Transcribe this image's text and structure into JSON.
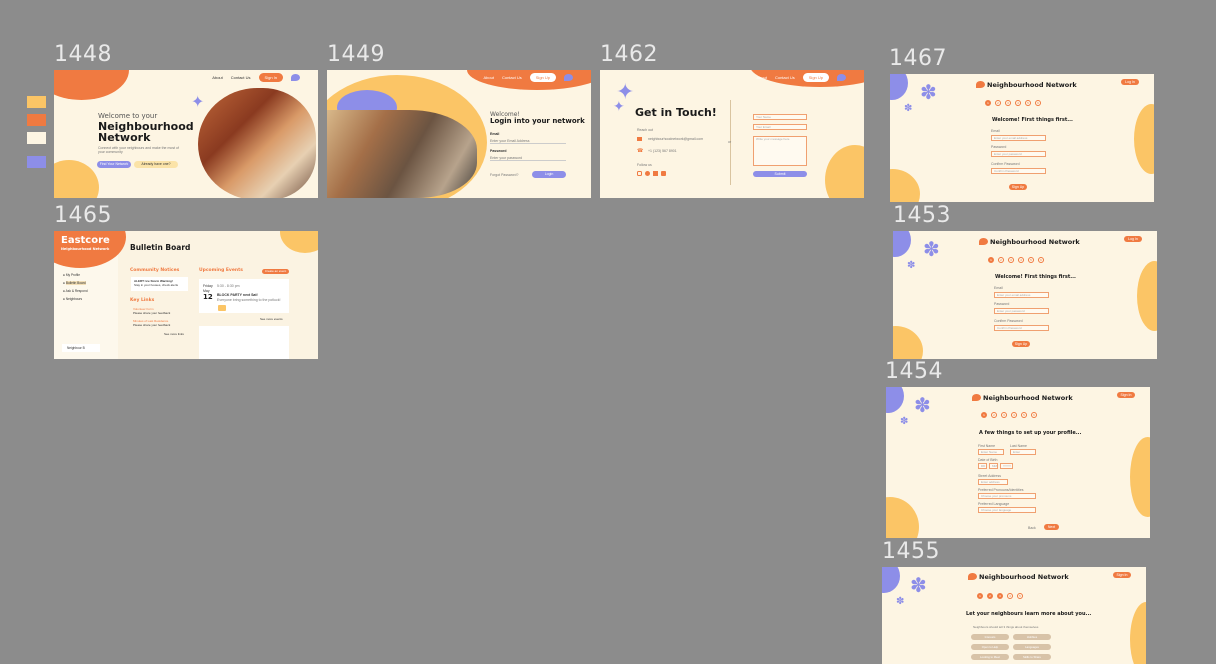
{
  "swatches": [
    "#fbc566",
    "#f07a41",
    "#fdf5e3",
    "#8d8ee8"
  ],
  "frames": {
    "f1448": {
      "label": "1448",
      "nav": [
        "About",
        "Contact Us",
        "Sign In"
      ],
      "welcome": "Welcome to your",
      "title_line1": "Neighbourhood",
      "title_line2": "Network",
      "description": "Connect with your neighbours and make the most of your community",
      "primary_btn": "Find Your Network",
      "secondary_btn": "Already have one?"
    },
    "f1449": {
      "label": "1449",
      "nav": [
        "About",
        "Contact Us",
        "Sign Up"
      ],
      "welcome": "Welcome!",
      "title": "Login into your network",
      "email_label": "Email",
      "email_placeholder": "Enter your Email Address",
      "password_label": "Password",
      "password_placeholder": "Enter your password",
      "forgot": "Forgot Password?",
      "login_btn": "Login"
    },
    "f1462": {
      "label": "1462",
      "nav": [
        "About",
        "Contact Us",
        "Sign Up"
      ],
      "title": "Get in Touch!",
      "reach": "Reach out",
      "email": "neighbourhoodnetwork@gmail.com",
      "phone": "+1 (123) 567 8901",
      "follow": "Follow us",
      "or": "or",
      "name_placeholder": "Your Name",
      "email_placeholder": "Your Email",
      "message_placeholder": "Write your message here",
      "submit": "Submit"
    },
    "f1467": {
      "label": "1467",
      "brand": "Neighbourhood Network",
      "login_btn": "Log In",
      "steps": [
        "1",
        "2",
        "3",
        "4",
        "5",
        "6"
      ],
      "heading": "Welcome! First things first...",
      "email_label": "Email",
      "email_placeholder": "Enter your email address",
      "password_label": "Password",
      "password_placeholder": "Enter your password",
      "confirm_label": "Confirm Password",
      "confirm_placeholder": "Confirm Password",
      "signup_btn": "Sign Up"
    },
    "f1465": {
      "label": "1465",
      "brand": "Eastcore",
      "brand_sub": "Neighbourhood Network",
      "menu": [
        "My Profile",
        "Bulletin Board",
        "Ask & Respond",
        "Neighbours"
      ],
      "user": "Neighbour B",
      "board_title": "Bulletin Board",
      "community_notices": "Community Notices",
      "notice_title": "ALERT: Ice Storm Warning!",
      "notice_body": "Stay in your houses, check alerts",
      "key_links": "Key Links",
      "link1_title": "Volunteer Form",
      "link1_body": "Please share your feedback",
      "link2_title": "Minutes of Last Residence",
      "link2_body": "Please share your feedback",
      "see_links": "See more links",
      "upcoming": "Upcoming Events",
      "create_event": "Create an event",
      "event_day": "Friday",
      "event_month": "May",
      "event_date": "12",
      "event_time": "5:30 - 8:30 pm",
      "event_title": "BLOCK PARTY next Sat!",
      "event_body": "Everyone bring something to the potluck!",
      "see_events": "See more events"
    },
    "f1453": {
      "label": "1453",
      "brand": "Neighbourhood Network",
      "login_btn": "Log In",
      "steps": [
        "1",
        "2",
        "3",
        "4",
        "5",
        "6"
      ],
      "heading": "Welcome! First things first...",
      "email_label": "Email",
      "email_placeholder": "Enter your email address",
      "password_label": "Password",
      "password_placeholder": "Enter your password",
      "confirm_label": "Confirm Password",
      "confirm_placeholder": "Confirm Password",
      "signup_btn": "Sign Up"
    },
    "f1454": {
      "label": "1454",
      "brand": "Neighbourhood Network",
      "login_btn": "Sign In",
      "steps": [
        "1",
        "2",
        "3",
        "4",
        "5",
        "6"
      ],
      "heading": "A few things to set up your profile...",
      "first_label": "First Name",
      "first_placeholder": "Enter Name",
      "last_label": "Last Name",
      "last_placeholder": "Enter",
      "dob_label": "Date of Birth",
      "dob_parts": [
        "DD",
        "MM",
        "YYYY"
      ],
      "address_label": "Street Address",
      "address_placeholder": "Enter address",
      "pronoun_label": "Preferred Pronouns/Identities",
      "pronoun_placeholder": "Choose your pronouns",
      "language_label": "Preferred Language",
      "language_placeholder": "Choose your language",
      "back_btn": "Back",
      "next_btn": "Next"
    },
    "f1455": {
      "label": "1455",
      "brand": "Neighbourhood Network",
      "login_btn": "Sign In",
      "steps": [
        "1",
        "2",
        "3",
        "4",
        "5"
      ],
      "heading": "Let your neighbours learn more about you...",
      "sub": "Neighbours should tell 3 things about themselves",
      "chips": [
        "Interests",
        "Hobbies",
        "Open to Help",
        "Languages",
        "Looking to Meet",
        "Skills to Share"
      ]
    }
  }
}
